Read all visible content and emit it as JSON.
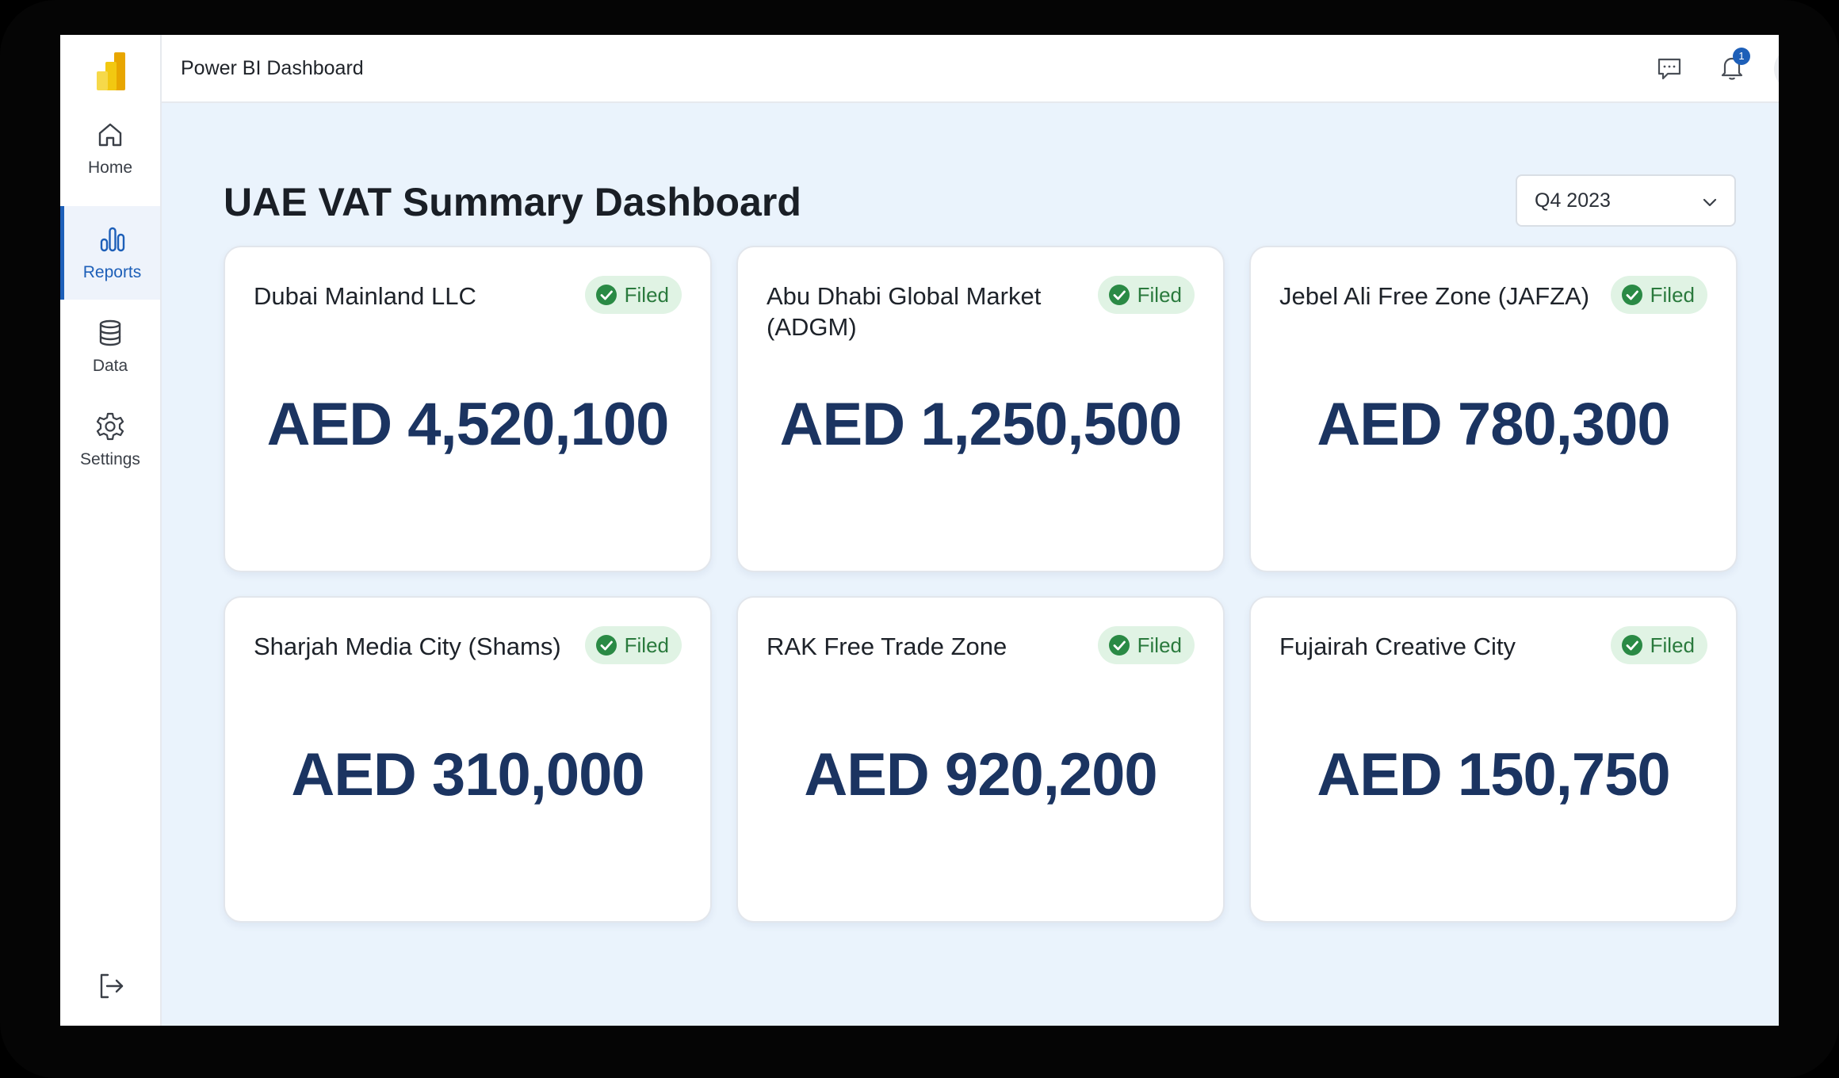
{
  "app": {
    "title": "Power BI Dashboard"
  },
  "sidebar": {
    "items": [
      {
        "label": "Home",
        "icon": "home-icon"
      },
      {
        "label": "Reports",
        "icon": "bar-chart-icon",
        "active": true
      },
      {
        "label": "Data",
        "icon": "database-icon"
      },
      {
        "label": "Settings",
        "icon": "gear-icon"
      }
    ],
    "logout_icon": "logout-icon"
  },
  "header": {
    "notification_count": "1"
  },
  "page": {
    "title": "UAE VAT Summary Dashboard",
    "period": "Q4 2023"
  },
  "cards": [
    {
      "name": "Dubai Mainland LLC",
      "status": "Filed",
      "amount": "AED 4,520,100"
    },
    {
      "name": "Abu Dhabi Global Market (ADGM)",
      "status": "Filed",
      "amount": "AED 1,250,500"
    },
    {
      "name": "Jebel Ali Free Zone (JAFZA)",
      "status": "Filed",
      "amount": "AED 780,300"
    },
    {
      "name": "Sharjah Media City (Shams)",
      "status": "Filed",
      "amount": "AED 310,000"
    },
    {
      "name": "RAK Free Trade Zone",
      "status": "Filed",
      "amount": "AED 920,200"
    },
    {
      "name": "Fujairah Creative City",
      "status": "Filed",
      "amount": "AED 150,750"
    }
  ],
  "colors": {
    "accent": "#1d5fb8",
    "amount": "#1b3461",
    "status_bg": "#e0f3e4",
    "status_text": "#2a7a3d",
    "main_bg": "#eaf3fc"
  }
}
